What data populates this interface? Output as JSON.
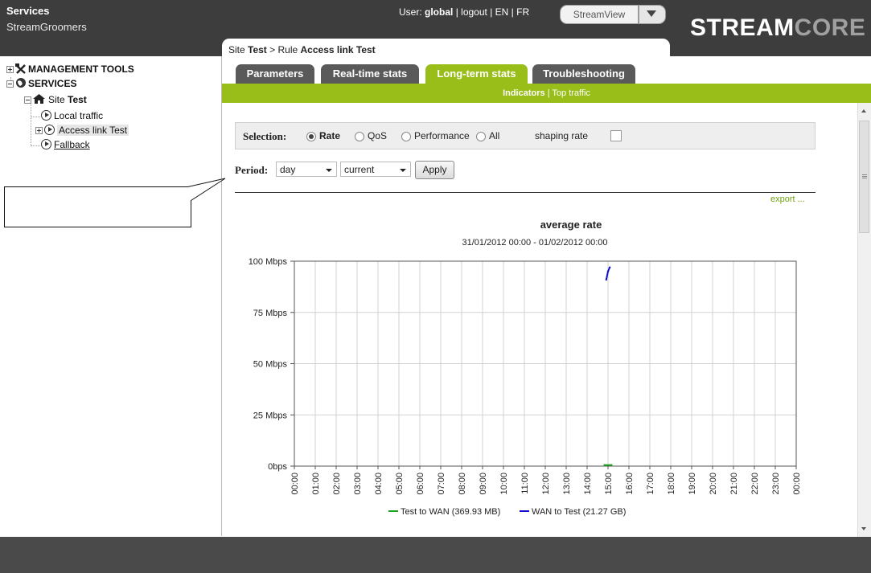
{
  "header": {
    "services_title": "Services",
    "services_sub": "StreamGroomers",
    "user_prefix": "User: ",
    "user_name": "global",
    "sep": " | ",
    "logout": "logout",
    "lang_en": "EN",
    "lang_fr": "FR",
    "view_selected": "StreamView",
    "logo_a": "STREAM",
    "logo_b": "CORE"
  },
  "breadcrumb": {
    "site_prefix": "Site ",
    "site_name": "Test",
    "rule_prefix": " > Rule ",
    "rule_name": "Access link Test"
  },
  "tabs": [
    {
      "label": "Parameters",
      "active": false
    },
    {
      "label": "Real-time stats",
      "active": false
    },
    {
      "label": "Long-term stats",
      "active": true
    },
    {
      "label": "Troubleshooting",
      "active": false
    }
  ],
  "subtabs": {
    "indicators": "Indicators",
    "sep": " | ",
    "top_traffic": "Top traffic"
  },
  "sidebar": {
    "management": "MANAGEMENT TOOLS",
    "services": "SERVICES",
    "site_prefix": "Site ",
    "site_name": "Test",
    "items": [
      "Local traffic",
      "Access link Test",
      "Fallback"
    ]
  },
  "selection": {
    "label": "Selection:",
    "options": [
      "Rate",
      "QoS",
      "Performance",
      "All"
    ],
    "selected": "Rate",
    "shaping_label": "shaping rate",
    "shaping_checked": false
  },
  "period": {
    "label": "Period:",
    "unit": "day",
    "which": "current",
    "apply": "Apply"
  },
  "export_label": "export ...",
  "chart_data": {
    "type": "line",
    "title": "average rate",
    "subtitle": "31/01/2012 00:00 - 01/02/2012 00:00",
    "y_ticks": [
      "100 Mbps",
      "75 Mbps",
      "50 Mbps",
      "25 Mbps",
      "0bps"
    ],
    "ylim": [
      0,
      100
    ],
    "y_unit": "Mbps",
    "x_ticks": [
      "00:00",
      "01:00",
      "02:00",
      "03:00",
      "04:00",
      "05:00",
      "06:00",
      "07:00",
      "08:00",
      "09:00",
      "10:00",
      "11:00",
      "12:00",
      "13:00",
      "14:00",
      "15:00",
      "16:00",
      "17:00",
      "18:00",
      "19:00",
      "20:00",
      "21:00",
      "22:00",
      "23:00",
      "00:00"
    ],
    "grid": true,
    "legend_position": "bottom",
    "series": [
      {
        "name": "Test to WAN (369.93 MB)",
        "color": "#1aa31a",
        "x": [
          "14:50",
          "15:10"
        ],
        "y": [
          0.5,
          0.5
        ]
      },
      {
        "name": "WAN to Test (21.27 GB)",
        "color": "#1010c8",
        "x": [
          "14:55",
          "15:00",
          "15:05"
        ],
        "y": [
          91,
          95,
          97
        ]
      }
    ]
  }
}
